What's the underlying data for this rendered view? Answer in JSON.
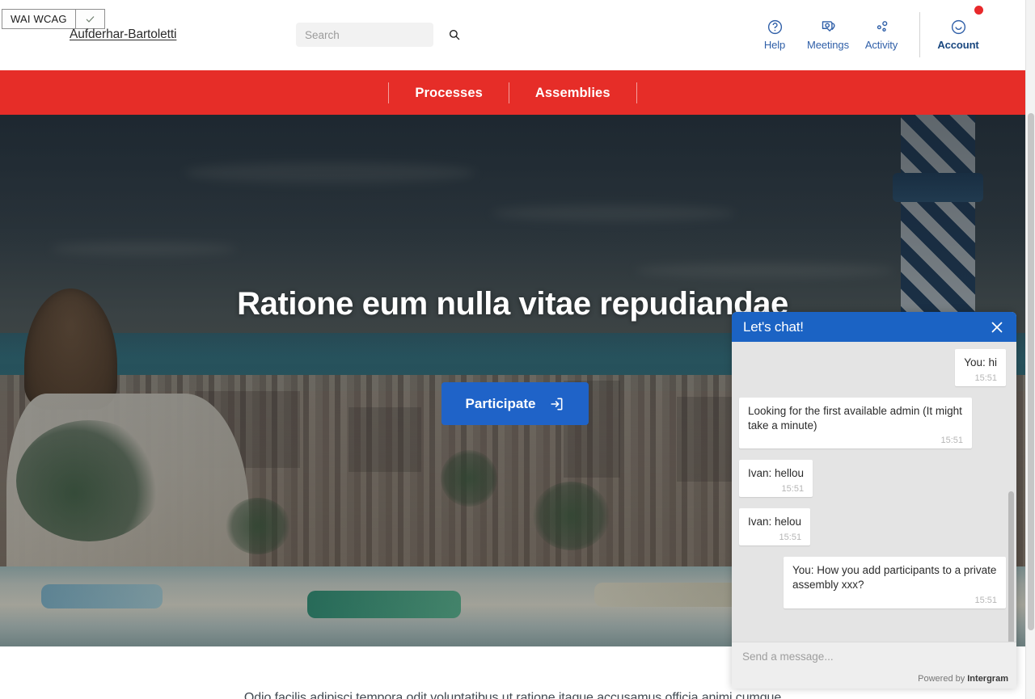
{
  "header": {
    "wcag_badge": "WAI WCAG",
    "wcag_check_icon": "check-icon",
    "organization": "Aufderhar-Bartoletti",
    "search": {
      "placeholder": "Search",
      "value": "",
      "icon": "search-icon"
    },
    "nav": [
      {
        "label": "Help",
        "icon": "question-circle-icon"
      },
      {
        "label": "Meetings",
        "icon": "map-pin-icon"
      },
      {
        "label": "Activity",
        "icon": "activity-dots-icon"
      },
      {
        "label": "Account",
        "icon": "smiley-face-icon",
        "has_notification": true
      }
    ]
  },
  "mainnav": {
    "items": [
      {
        "label": "Processes"
      },
      {
        "label": "Assemblies"
      }
    ]
  },
  "hero": {
    "title": "Ratione eum nulla vitae repudiandae",
    "cta_label": "Participate",
    "cta_icon": "login-arrow-icon"
  },
  "content": {
    "paragraph": "Odio facilis adipisci tempora odit voluptatibus ut ratione itaque accusamus officia animi cumque"
  },
  "chat": {
    "title": "Let's chat!",
    "close_icon": "close-icon",
    "messages": [
      {
        "text": "You: hi",
        "time": "15:51",
        "side": "right"
      },
      {
        "text": "Looking for the first available admin (It might take a minute)",
        "time": "15:51",
        "side": "left"
      },
      {
        "text": "Ivan: hellou",
        "time": "15:51",
        "side": "left"
      },
      {
        "text": "Ivan: helou",
        "time": "15:51",
        "side": "left"
      },
      {
        "text": "You: How you add participants to a private assembly xxx?",
        "time": "15:51",
        "side": "right"
      }
    ],
    "input_placeholder": "Send a message...",
    "input_value": "",
    "powered_by_prefix": "Powered by",
    "powered_by_brand": "Intergram"
  },
  "colors": {
    "brand_red": "#E62D28",
    "brand_blue": "#1F63C8",
    "chat_blue": "#1B63C4",
    "nav_link": "#2F5FA8",
    "notification": "#E8292B"
  }
}
